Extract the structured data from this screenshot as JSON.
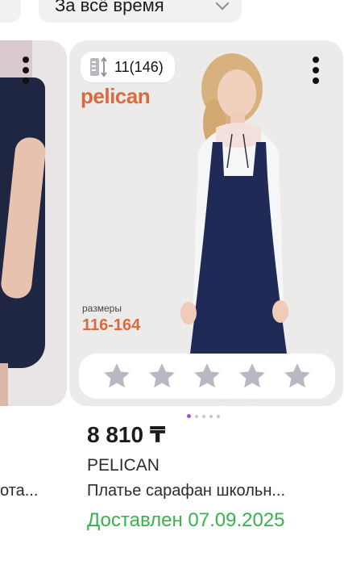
{
  "filter_chip": {
    "label": "За всё время"
  },
  "left_card": {
    "title_fragment": "ота..."
  },
  "product": {
    "size_count": "11(146)",
    "brand_logo": "pelican",
    "sizes_label": "размеры",
    "sizes_range": "116-164",
    "price": "8 810 ₸",
    "brand": "PELICAN",
    "title": "Платье сарафан школьн...",
    "delivery": "Доставлен 07.09.2025",
    "rating_stars": 0,
    "rating_max": 5
  },
  "pagination": {
    "total": 5,
    "active": 0
  },
  "colors": {
    "accent": "#a24bdc",
    "delivery_green": "#37b24d",
    "brand_orange": "#d86a3f",
    "star_gray": "#b9b9c3"
  },
  "icons": [
    "chevron-down-icon",
    "size-icon",
    "more-vertical-icon",
    "star-icon"
  ]
}
